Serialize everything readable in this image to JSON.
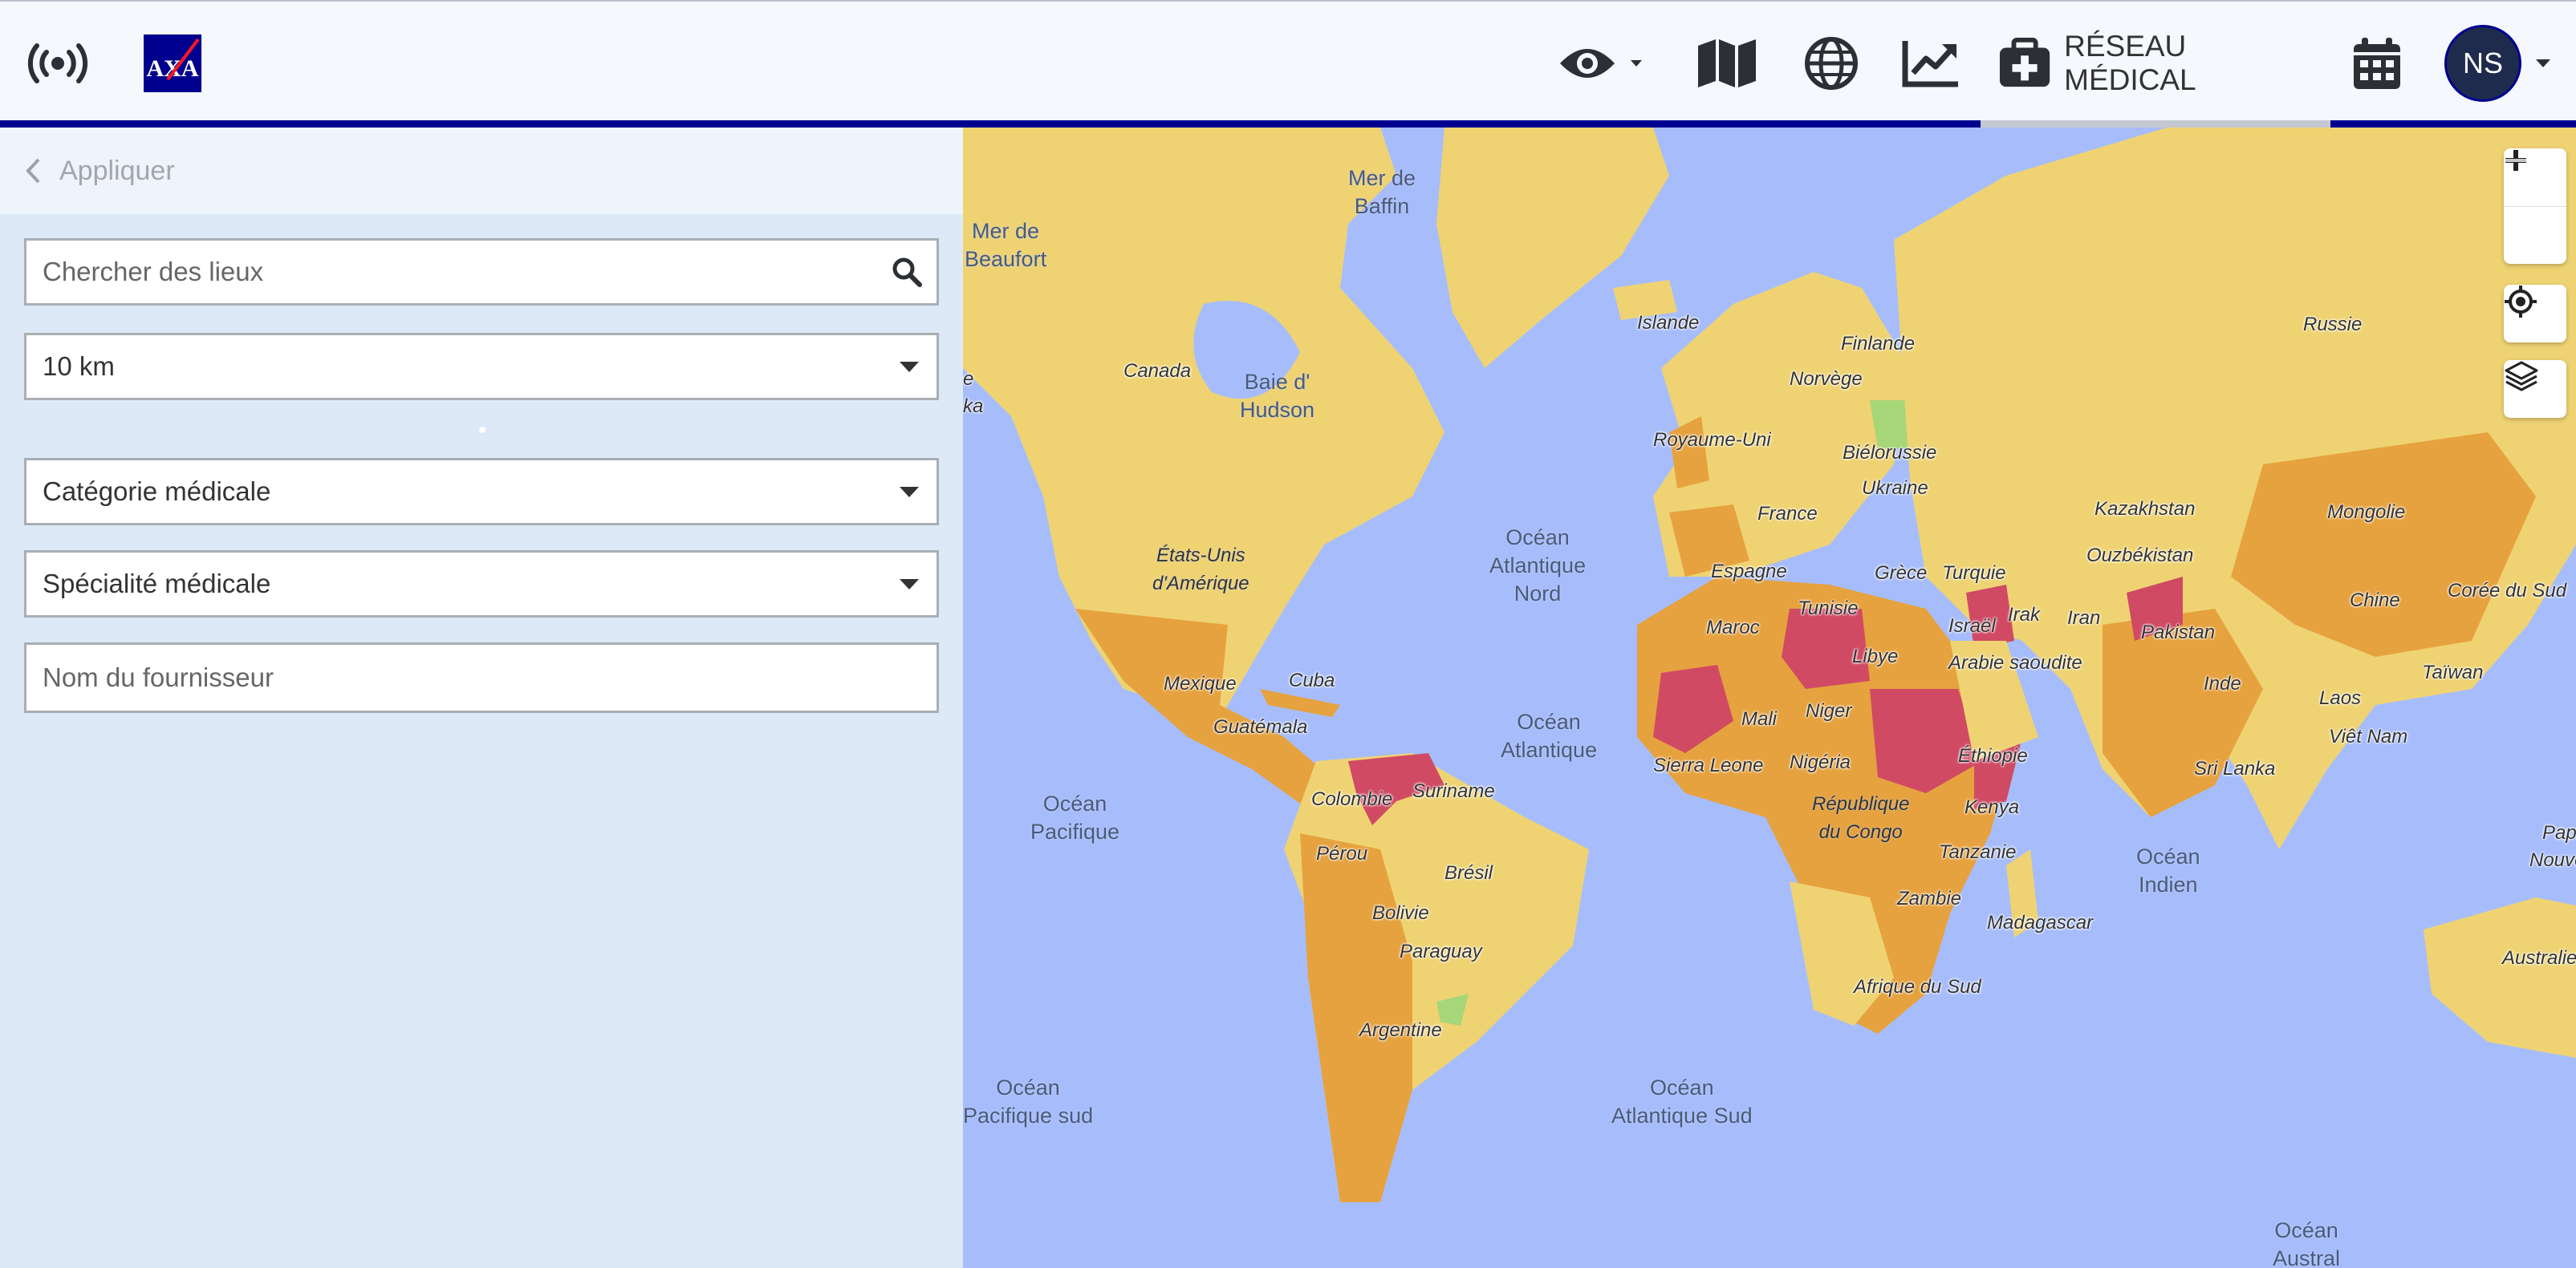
{
  "header": {
    "nav_label": "RÉSEAU MÉDICAL",
    "avatar_initials": "NS",
    "brand_color": "#00008f",
    "icons": [
      "broadcast-icon",
      "axa-logo",
      "eye-icon",
      "map-icon",
      "globe-icon",
      "chart-line-icon",
      "medical-kit-icon",
      "calendar-icon"
    ]
  },
  "sidebar": {
    "apply_label": "Appliquer",
    "search": {
      "placeholder": "Chercher des lieux",
      "value": ""
    },
    "radius": {
      "value": "10 km"
    },
    "category": {
      "value": "Catégorie médicale"
    },
    "specialty": {
      "value": "Spécialité médicale"
    },
    "provider": {
      "placeholder": "Nom du fournisseur",
      "value": ""
    }
  },
  "map": {
    "colors": {
      "water": "#a7bdfb",
      "low": "#efd373",
      "medium": "#e6a23e",
      "high": "#e39a45",
      "extreme": "#d04a64",
      "minimal": "#a7d678"
    },
    "labels": {
      "mer_baffin": "Mer de\nBaffin",
      "mer_beaufort": "Mer de\nBeaufort",
      "islande": "Islande",
      "russie": "Russie",
      "canada": "Canada",
      "baie_hudson": "Baie d'\nHudson",
      "finlande": "Finlande",
      "norvege": "Norvège",
      "royaume_uni": "Royaume-Uni",
      "bielorussie": "Biélorussie",
      "ukraine": "Ukraine",
      "kazakhstan": "Kazakhstan",
      "mongolie": "Mongolie",
      "france": "France",
      "etats_unis": "États-Unis\nd'Amérique",
      "ocean_atl_nord": "Océan\nAtlantique\nNord",
      "espagne": "Espagne",
      "grece": "Grèce",
      "turquie": "Turquie",
      "ouzbekistan": "Ouzbékistan",
      "coree_sud": "Corée du Sud",
      "maroc": "Maroc",
      "tunisie": "Tunisie",
      "israel": "Israël",
      "irak": "Irak",
      "iran": "Iran",
      "pakistan": "Pakistan",
      "chine": "Chine",
      "libye": "Libye",
      "arabie": "Arabie saoudite",
      "mexique": "Mexique",
      "cuba": "Cuba",
      "inde": "Inde",
      "taiwan": "Taïwan",
      "guatemala": "Guatémala",
      "ocean_atl": "Océan\nAtlantique",
      "mali": "Mali",
      "niger": "Niger",
      "laos": "Laos",
      "vietnam": "Viêt Nam",
      "sierra_leone": "Sierra Leone",
      "nigeria": "Nigéria",
      "ethiopie": "Éthiopie",
      "sri_lanka": "Sri Lanka",
      "colombie": "Colombie",
      "suriname": "Suriname",
      "ocean_pacifique": "Océan\nPacifique",
      "rdc": "République\ndu Congo",
      "kenya": "Kenya",
      "perou": "Pérou",
      "tanzanie": "Tanzanie",
      "ocean_indien": "Océan\nIndien",
      "pap": "Pap",
      "nouve": "Nouve",
      "bresil": "Brésil",
      "zambie": "Zambie",
      "bolivie": "Bolivie",
      "madagascar": "Madagascar",
      "paraguay": "Paraguay",
      "afrique_sud": "Afrique du Sud",
      "australie": "Australie",
      "argentine": "Argentine",
      "ocean_pac_sud": "Océan\nPacifique sud",
      "ocean_atl_sud": "Océan\nAtlantique Sud",
      "ocean_austral": "Océan\nAustral",
      "edge_ka": "ka",
      "edge_e": "e"
    }
  }
}
